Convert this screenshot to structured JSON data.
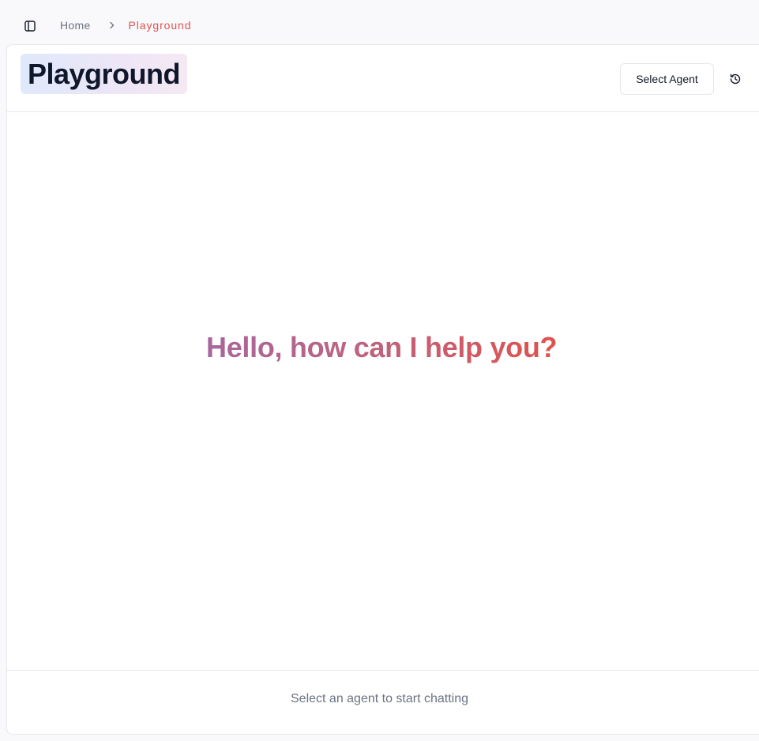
{
  "topbar": {
    "sidebar_toggle_icon": "panel-left-icon",
    "breadcrumb": {
      "home_label": "Home",
      "separator_icon": "chevron-right-icon",
      "current_label": "Playground"
    }
  },
  "header": {
    "title": "Playground",
    "select_agent_label": "Select Agent",
    "history_icon": "history-icon"
  },
  "chat": {
    "greeting": "Hello, how can I help you?"
  },
  "footer": {
    "hint": "Select an agent to start chatting"
  },
  "colors": {
    "accent": "#e0524c",
    "greeting_gradient_start": "#a8679c",
    "greeting_gradient_end": "#e0524c",
    "border": "#e5e7eb",
    "muted_text": "#6b7280"
  }
}
